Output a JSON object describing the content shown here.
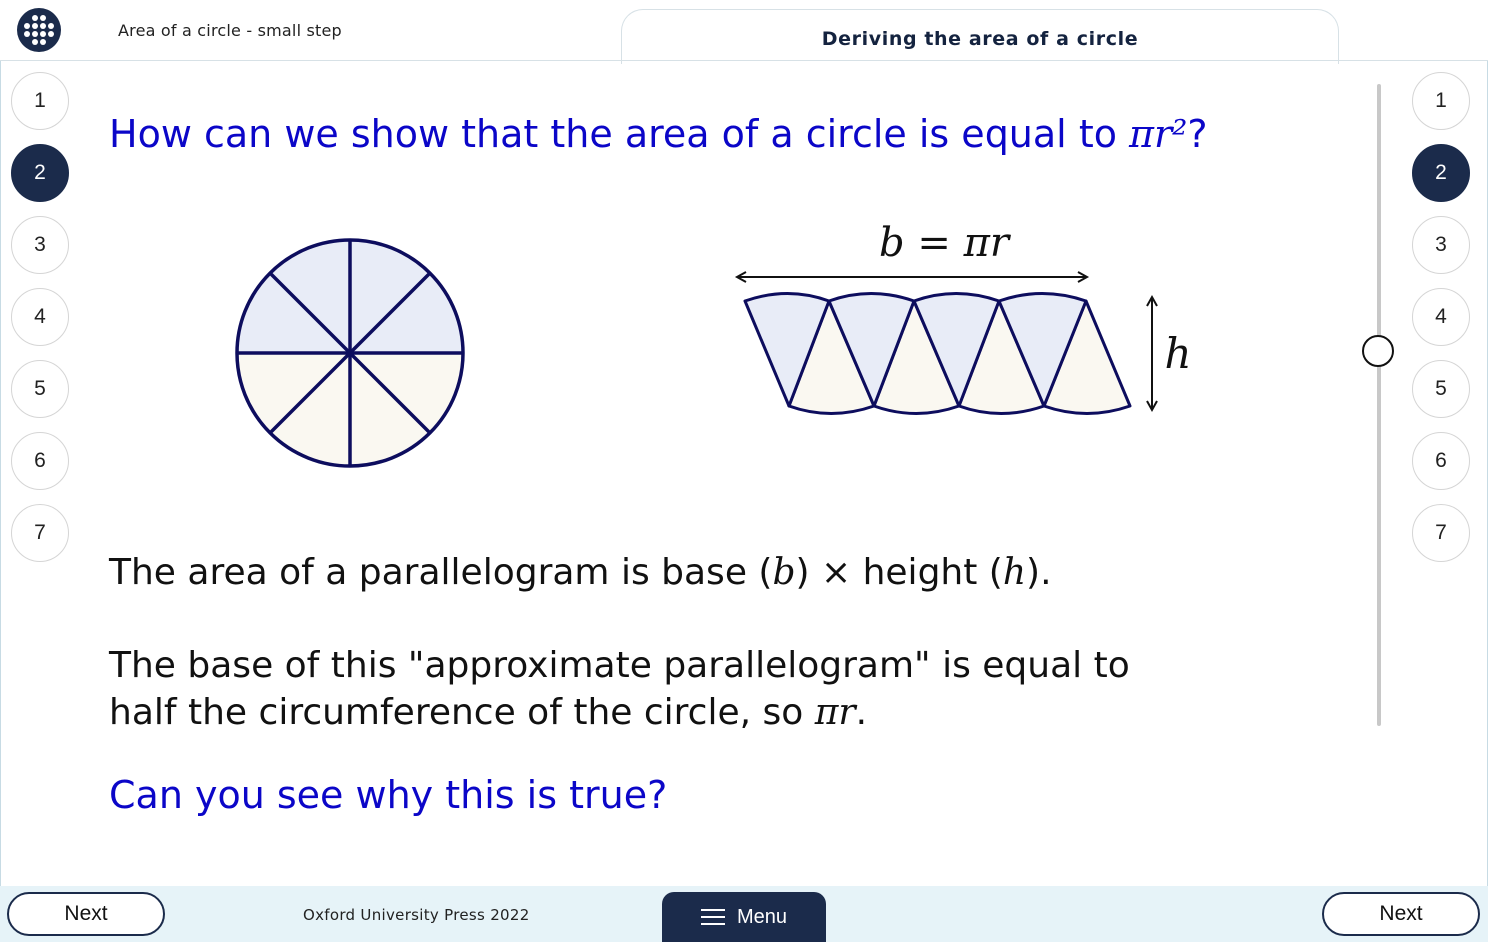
{
  "header": {
    "apps_icon": "grid-dots-icon",
    "breadcrumb": "Area of a circle - small step",
    "title": "Deriving the area of a circle"
  },
  "steps": [
    "1",
    "2",
    "3",
    "4",
    "5",
    "6",
    "7"
  ],
  "active_step": "2",
  "main": {
    "question_text": "How can we show that the area of a circle is equal to ",
    "question_math": "πr²",
    "question_end": "?",
    "diagram": {
      "base_label": "b = πr",
      "height_label": "h"
    },
    "para1": {
      "t1": "The area of a parallelogram is base (",
      "m1": "b",
      "t2": ") × height (",
      "m2": "h",
      "t3": ")."
    },
    "para2": {
      "line1": "The base of this \"approximate parallelogram\" is equal to",
      "line2": "half the circumference of the circle, so ",
      "math": "πr",
      "end": "."
    },
    "prompt": "Can you see why this is true?"
  },
  "footer": {
    "next_left": "Next",
    "copyright": "Oxford University Press 2022",
    "menu_label": "Menu",
    "menu_icon": "hamburger-icon",
    "next_right": "Next"
  },
  "colors": {
    "navy": "#1b2b4b",
    "question_blue": "#0b06c8",
    "sector_top": "#e8ecf7",
    "sector_bottom": "#faf8f1",
    "footer_bg": "#e6f3f8"
  }
}
